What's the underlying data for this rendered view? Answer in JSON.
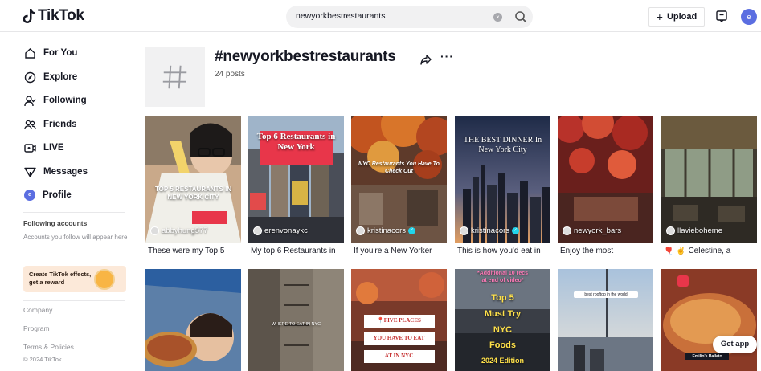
{
  "header": {
    "logo_text": "TikTok",
    "search_value": "newyorkbestrestaurants",
    "upload_label": "Upload",
    "avatar_initial": "e"
  },
  "sidebar": {
    "nav": [
      {
        "label": "For You",
        "icon": "home-icon"
      },
      {
        "label": "Explore",
        "icon": "compass-icon"
      },
      {
        "label": "Following",
        "icon": "following-icon"
      },
      {
        "label": "Friends",
        "icon": "friends-icon"
      },
      {
        "label": "LIVE",
        "icon": "live-icon"
      },
      {
        "label": "Messages",
        "icon": "messages-icon"
      },
      {
        "label": "Profile",
        "icon": "profile-avatar"
      }
    ],
    "following_title": "Following accounts",
    "following_hint": "Accounts you follow will appear here",
    "effects_text": "Create TikTok effects, get a reward",
    "footer_links": [
      "Company",
      "Program",
      "Terms & Policies"
    ],
    "copyright": "© 2024 TikTok"
  },
  "hashtag": {
    "title": "#newyorkbestrestaurants",
    "post_count": "24 posts"
  },
  "videos_row1": [
    {
      "author": "abbyhung577",
      "caption": "These were my Top 5",
      "overlay": "TOP 5 RESTAURANTS IN NEW YORK CITY",
      "verified": false
    },
    {
      "author": "erenvonaykc",
      "caption": "My top 6 Restaurants in",
      "overlay": "Top 6 Restaurants in New York",
      "verified": false
    },
    {
      "author": "kristinacors",
      "caption": "If you're a New Yorker",
      "overlay": "NYC Restaurants You Have To Check Out",
      "verified": true
    },
    {
      "author": "kristinacors",
      "caption": "This is how you'd eat in",
      "overlay": "THE BEST DINNER In New York City",
      "verified": true
    },
    {
      "author": "newyork_bars",
      "caption": "Enjoy the most",
      "overlay": "",
      "verified": false
    },
    {
      "author": "llavieboheme",
      "caption": "🎈 ✌️ Celestine, a",
      "overlay": "",
      "verified": false
    }
  ],
  "videos_row2": [
    {
      "overlay": ""
    },
    {
      "overlay": "WHERE TO EAT IN NYC"
    },
    {
      "overlay_lines": [
        "📍FIVE PLACES",
        "YOU HAVE TO EAT",
        "AT IN NYC"
      ]
    },
    {
      "overlay_lines": [
        "*Additional 10 recs",
        "at end of video*",
        "Top 5",
        "Must Try",
        "NYC",
        "Foods",
        "2024 Edition"
      ]
    },
    {
      "overlay": "best rooftop in the world"
    },
    {
      "overlay": "Emilio's Ballato"
    }
  ],
  "get_app_label": "Get app"
}
